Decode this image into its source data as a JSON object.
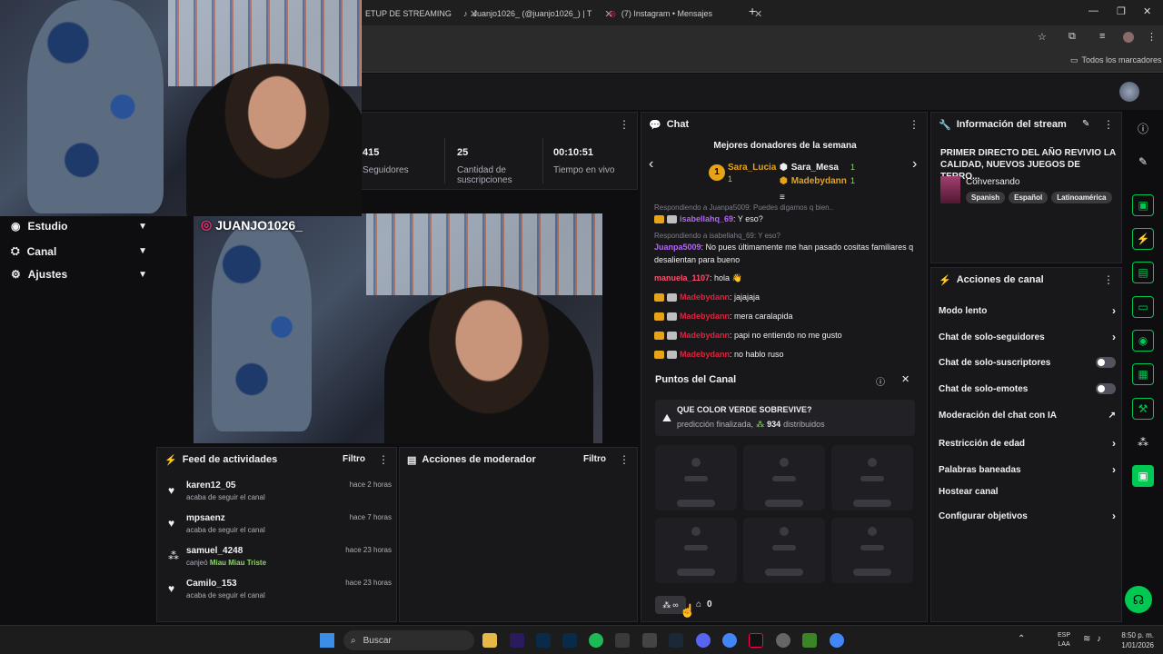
{
  "browser": {
    "tabs": [
      {
        "title": "ETUP DE STREAMING"
      },
      {
        "title": "Juanjo1026_ (@juanjo1026_) | T"
      },
      {
        "title": "(7) Instagram • Mensajes"
      }
    ],
    "bookmarks_label": "Todos los marcadores"
  },
  "overlay": {
    "handle": "JUANJO1026_"
  },
  "sidebar": {
    "items": [
      {
        "label": "Estudio",
        "icon": "studio-icon"
      },
      {
        "label": "Canal",
        "icon": "channel-icon"
      },
      {
        "label": "Ajustes",
        "icon": "gear-icon"
      }
    ]
  },
  "stats": [
    {
      "value": "415",
      "label": "Seguidores"
    },
    {
      "value": "25",
      "label": "Cantidad de suscripciones"
    },
    {
      "value": "00:10:51",
      "label": "Tiempo en vivo"
    }
  ],
  "feed": {
    "title": "Feed de actividades",
    "filter": "Filtro",
    "items": [
      {
        "name": "karen12_05",
        "sub": "acaba de seguir el canal",
        "time": "hace 2 horas",
        "icon": "heart-icon"
      },
      {
        "name": "mpsaenz",
        "sub": "acaba de seguir el canal",
        "time": "hace 7 horas",
        "icon": "heart-icon"
      },
      {
        "name": "samuel_4248",
        "sub": "canjeó",
        "reward": "Miau Miau Triste",
        "time": "hace 23 horas",
        "icon": "points-icon"
      },
      {
        "name": "Camilo_153",
        "sub": "acaba de seguir el canal",
        "time": "hace 23 horas",
        "icon": "heart-icon"
      }
    ]
  },
  "modactions": {
    "title": "Acciones de moderador",
    "filter": "Filtro"
  },
  "chat": {
    "title": "Chat",
    "donors_title": "Mejores donadores de la semana",
    "donors": [
      {
        "rank": "1",
        "name": "Sara_Lucia",
        "amount": "1"
      },
      {
        "name": "Sara_Mesa",
        "amount": "1"
      },
      {
        "name": "Madebydann",
        "amount": "1"
      }
    ],
    "messages": [
      {
        "reply": "Respondiendo a Juanpa5009: Puedes digamos q bien..",
        "user": "isabellahq_69",
        "color": "#b565f5",
        "text": ": Y eso?"
      },
      {
        "reply": "Respondiendo a isabellahq_69: Y eso?",
        "user": "Juanpa5009",
        "color": "#b565f5",
        "text": ": No pues últimamente me han pasado cositas familiares q desalientan para bueno"
      },
      {
        "user": "manuela_1107",
        "color": "#ff4f6e",
        "text": ": hola 👋"
      },
      {
        "user": "Madebydann",
        "color": "#e0233f",
        "text": ": jajajaja"
      },
      {
        "user": "Madebydann",
        "color": "#e0233f",
        "text": ": mera caralapida"
      },
      {
        "user": "Madebydann",
        "color": "#e0233f",
        "text": ": papi no entiendo no me gusto"
      },
      {
        "user": "Madebydann",
        "color": "#e0233f",
        "text": ": no hablo ruso"
      }
    ]
  },
  "points": {
    "title": "Puntos del Canal",
    "prediction_title": "QUE COLOR VERDE SOBREVIVE?",
    "prediction_status": "predicción finalizada,",
    "prediction_amount": "934",
    "prediction_suffix": "distribuidos",
    "infinity": "∞",
    "store_count": "0"
  },
  "streaminfo": {
    "title": "Información del stream",
    "stream_title": "PRIMER DIRECTO DEL AÑO REVIVIO LA CALIDAD, NUEVOS JUEGOS DE TERRO...",
    "category": "Conversando",
    "tags": [
      "Spanish",
      "Español",
      "Latinoamérica"
    ]
  },
  "channelactions": {
    "title": "Acciones de canal",
    "items": [
      {
        "label": "Modo lento",
        "kind": "arrow"
      },
      {
        "label": "Chat de solo-seguidores",
        "kind": "arrow"
      },
      {
        "label": "Chat de solo-suscriptores",
        "kind": "toggle"
      },
      {
        "label": "Chat de solo-emotes",
        "kind": "toggle"
      },
      {
        "label": "Moderación del chat con IA",
        "kind": "external"
      },
      {
        "label": "Restricción de edad",
        "kind": "arrow"
      },
      {
        "label": "Palabras baneadas",
        "kind": "arrow"
      },
      {
        "label": "Hostear canal",
        "kind": "none"
      },
      {
        "label": "Configurar objetivos",
        "kind": "arrow"
      }
    ]
  },
  "taskbar": {
    "search": "Buscar",
    "lang": "ESP",
    "region": "LAA",
    "time": "8:50 p. m.",
    "date": "1/01/2026"
  },
  "colors": {
    "accent": "#9147ff",
    "green": "#00c853",
    "gold": "#e6a317",
    "bg": "#0e0e10",
    "panel": "#18181b"
  }
}
